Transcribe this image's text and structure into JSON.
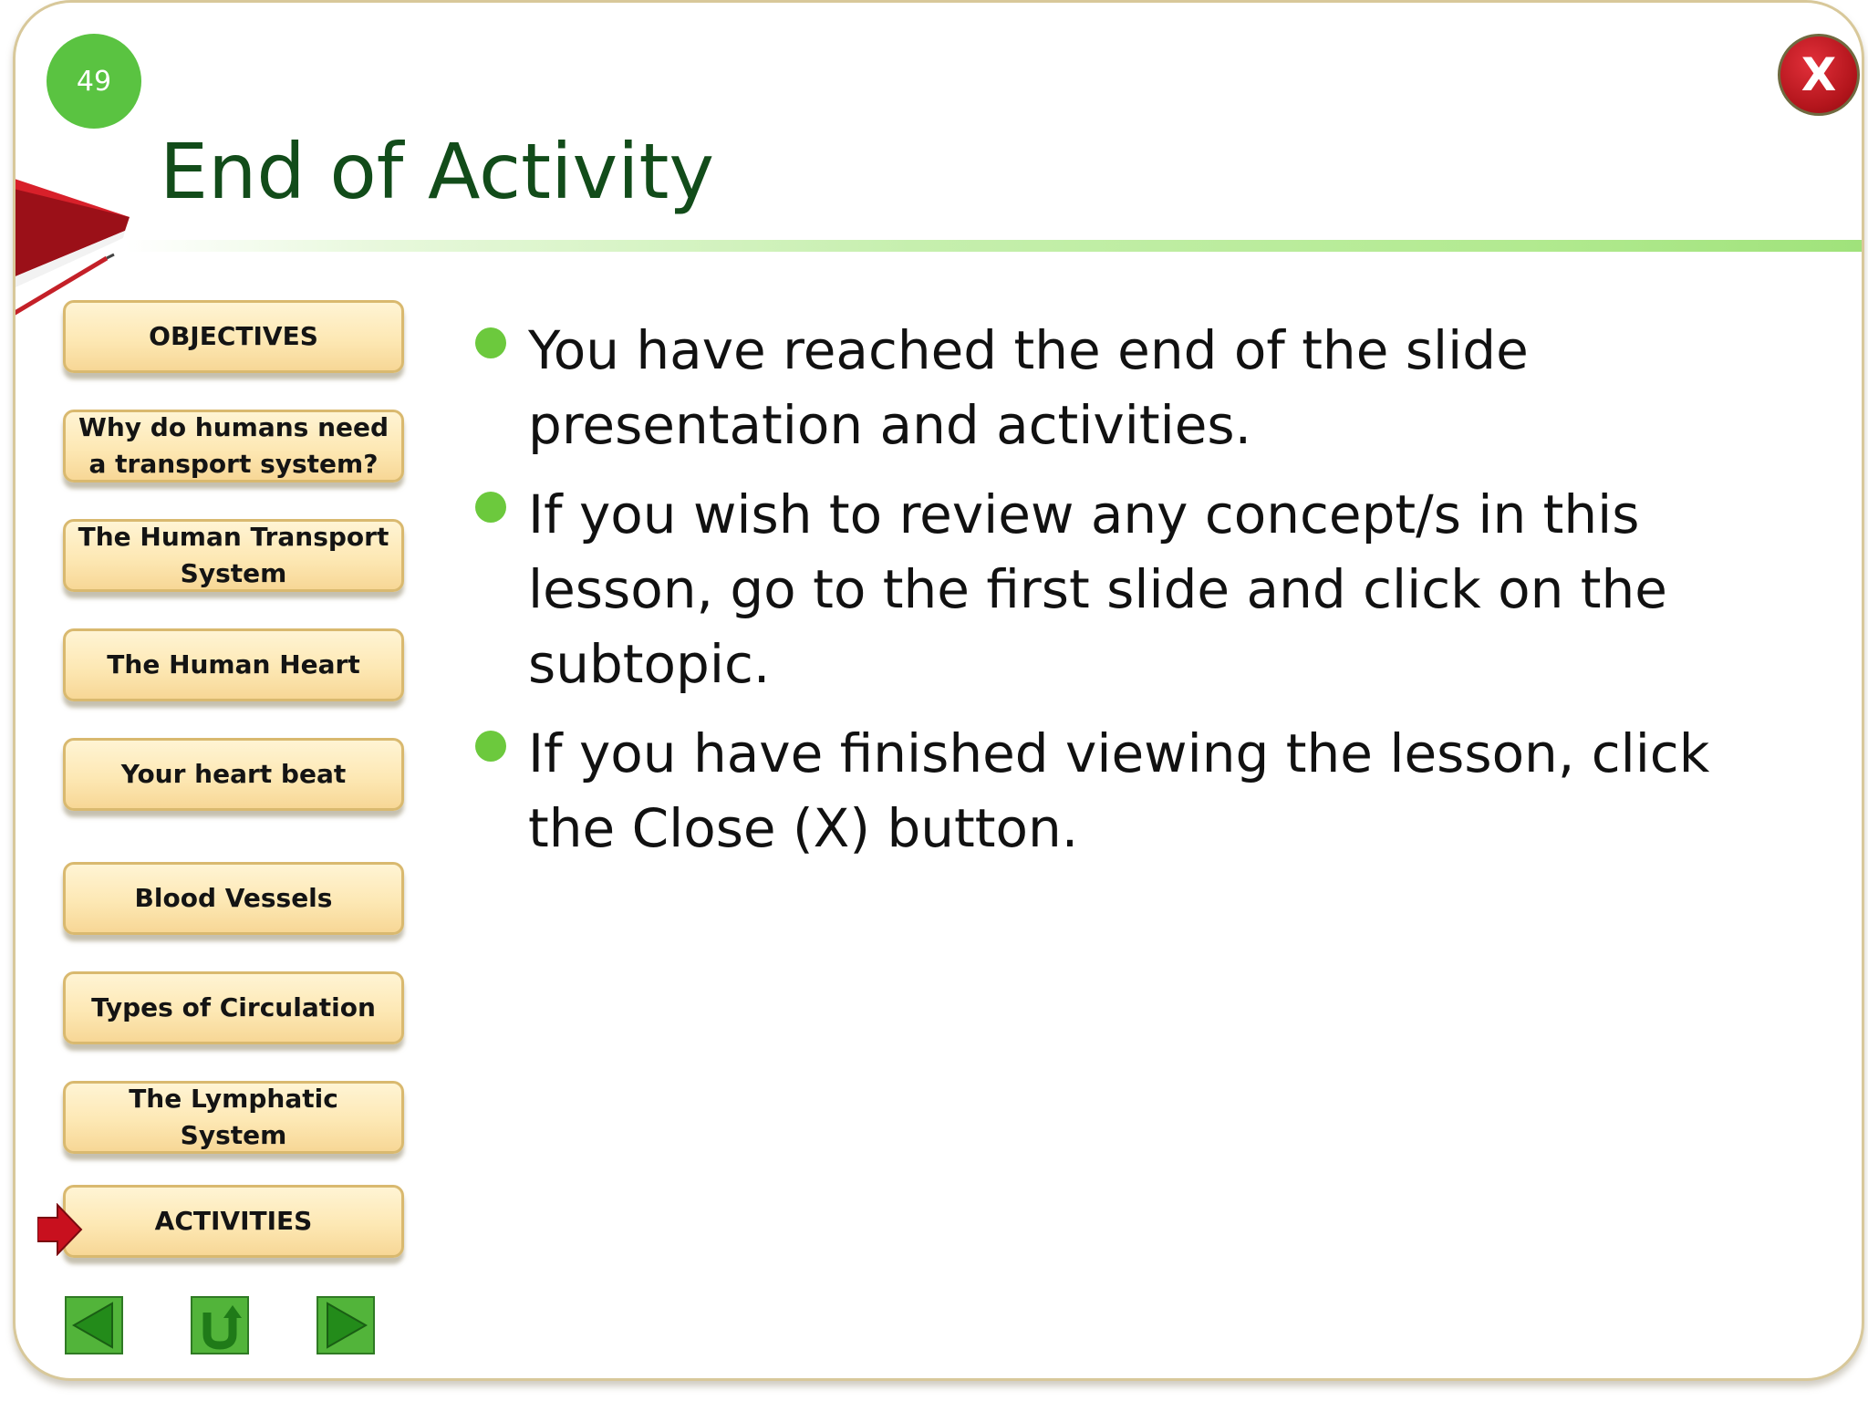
{
  "slide": {
    "page_number": "49",
    "title": "End of Activity",
    "close_label": "X"
  },
  "nav": {
    "items": [
      {
        "label": "OBJECTIVES"
      },
      {
        "label": "Why do humans need a transport system?"
      },
      {
        "label": "The Human Transport System"
      },
      {
        "label": "The Human Heart"
      },
      {
        "label": "Your heart beat"
      },
      {
        "label": "Blood Vessels"
      },
      {
        "label": "Types  of Circulation"
      },
      {
        "label": "The Lymphatic System"
      },
      {
        "label": "ACTIVITIES"
      }
    ],
    "current": "ACTIVITIES"
  },
  "controls": {
    "back_icon": "left-triangle-icon",
    "return_icon": "u-turn-icon",
    "next_icon": "right-triangle-icon"
  },
  "content": {
    "bullets": [
      "You have reached the end of the slide presentation and activities.",
      "If you wish to review any concept/s in this lesson, go to the first slide and click on the subtopic.",
      "If you have finished viewing the lesson, click the Close  (X) button."
    ]
  },
  "colors": {
    "title": "#124c1a",
    "badge": "#5ac341",
    "bullet": "#6cc93d",
    "close": "#c0161e",
    "nav_bg": "#fde8b4",
    "control_green": "#4fb83a"
  }
}
